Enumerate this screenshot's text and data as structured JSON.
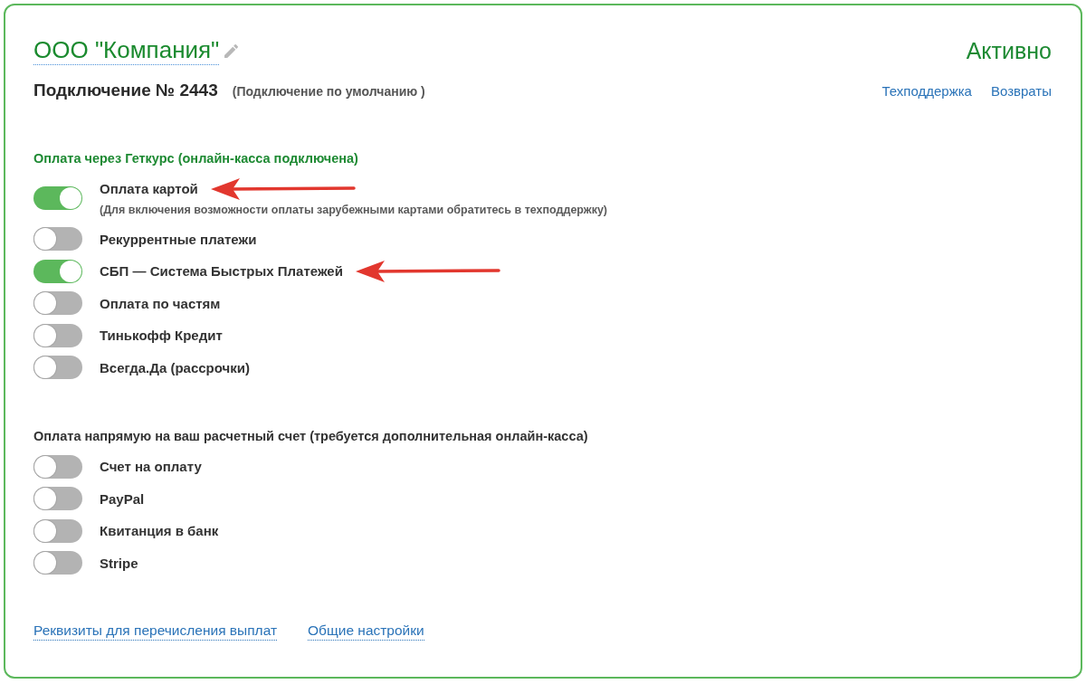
{
  "company": {
    "name": "ООО \"Компания\""
  },
  "status": "Активно",
  "connection": {
    "title": "Подключение № 2443",
    "note": "(Подключение по умолчанию )"
  },
  "header_links": [
    "Техподдержка",
    "Возвраты"
  ],
  "sections": [
    {
      "heading": "Оплата через Геткурс (онлайн-касса подключена)",
      "connected": true,
      "items": [
        {
          "label": "Оплата картой",
          "note": "(Для включения возможности оплаты зарубежными картами обратитесь в техподдержку)",
          "on": true,
          "arrow": true
        },
        {
          "label": "Рекуррентные платежи",
          "on": false,
          "arrow": false
        },
        {
          "label": "СБП — Система Быстрых Платежей",
          "on": true,
          "arrow": true
        },
        {
          "label": "Оплата по частям",
          "on": false,
          "arrow": false
        },
        {
          "label": "Тинькофф Кредит",
          "on": false,
          "arrow": false
        },
        {
          "label": "Всегда.Да (рассрочки)",
          "on": false,
          "arrow": false
        }
      ]
    },
    {
      "heading": "Оплата напрямую на ваш расчетный счет (требуется дополнительная онлайн-касса)",
      "connected": false,
      "items": [
        {
          "label": "Счет на оплату",
          "on": false,
          "arrow": false
        },
        {
          "label": "PayPal",
          "on": false,
          "arrow": false
        },
        {
          "label": "Квитанция в банк",
          "on": false,
          "arrow": false
        },
        {
          "label": "Stripe",
          "on": false,
          "arrow": false
        }
      ]
    }
  ],
  "footer_links": [
    "Реквизиты для перечисления выплат",
    "Общие настройки"
  ]
}
